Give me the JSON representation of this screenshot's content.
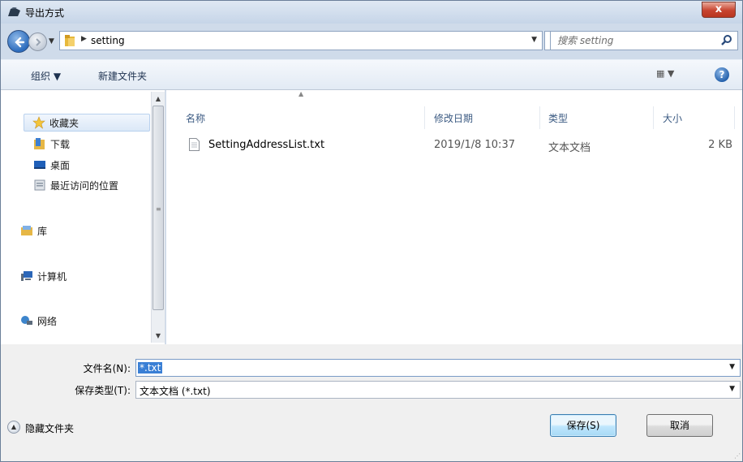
{
  "window": {
    "title": "导出方式",
    "close_label": "x"
  },
  "address": {
    "crumb": "setting",
    "search_placeholder": "搜索 setting"
  },
  "toolbar": {
    "organize": "组织 ▼",
    "new_folder": "新建文件夹",
    "view_label": "▦ ▼",
    "help_label": "?"
  },
  "nav": {
    "items": [
      {
        "label": "收藏夹",
        "icon": "star-icon"
      },
      {
        "label": "下载",
        "icon": "downloads-folder-icon"
      },
      {
        "label": "桌面",
        "icon": "desktop-icon"
      },
      {
        "label": "最近访问的位置",
        "icon": "recent-places-icon"
      },
      {
        "label": "库",
        "icon": "library-icon"
      },
      {
        "label": "计算机",
        "icon": "computer-icon"
      },
      {
        "label": "网络",
        "icon": "network-icon"
      }
    ]
  },
  "columns": {
    "name": "名称",
    "date": "修改日期",
    "type": "类型",
    "size": "大小"
  },
  "files": [
    {
      "name": "SettingAddressList.txt",
      "date": "2019/1/8 10:37",
      "type": "文本文档",
      "size": "2 KB"
    }
  ],
  "form": {
    "filename_label": "文件名(N):",
    "filename_value": "*.txt",
    "filetype_label": "保存类型(T):",
    "filetype_value": "文本文档 (*.txt)",
    "hide_folders": "隐藏文件夹",
    "save": "保存(S)",
    "cancel": "取消"
  },
  "colors": {
    "accent": "#3a7fd5",
    "header_text": "#3b5a82",
    "window_bg": "#cfdbea"
  }
}
